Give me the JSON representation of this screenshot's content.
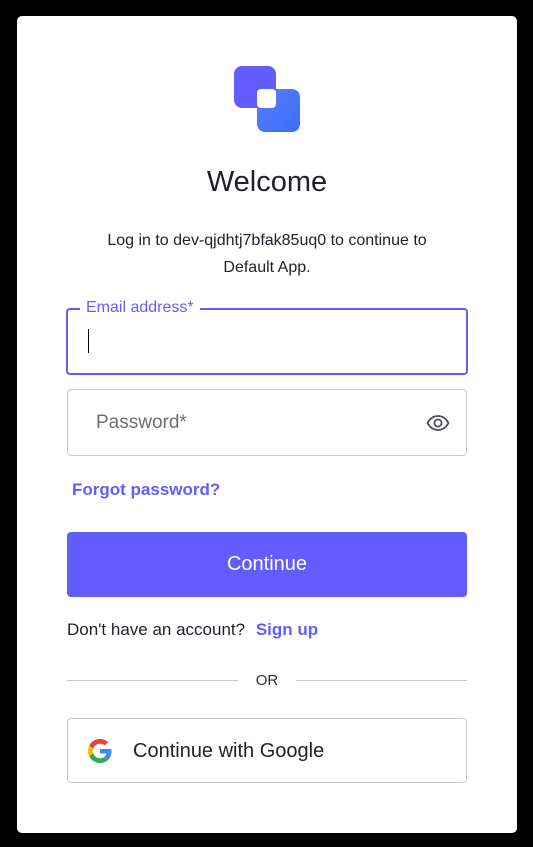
{
  "header": {
    "logo_icon": "app-logo-icon",
    "title": "Welcome",
    "subtitle_line1": "Log in to dev-qjdhtj7bfak85uq0 to continue to",
    "subtitle_line2": "Default App."
  },
  "form": {
    "email_label": "Email address*",
    "email_value": "",
    "password_placeholder": "Password*",
    "password_toggle_icon": "eye-icon",
    "forgot_password": "Forgot password?",
    "continue_label": "Continue"
  },
  "signup": {
    "prompt": "Don't have an account?",
    "link": "Sign up"
  },
  "divider": {
    "text": "OR"
  },
  "social": {
    "google_icon": "google-icon",
    "google_label": "Continue with Google"
  },
  "colors": {
    "accent": "#635dff",
    "logo_light": "#635dff",
    "logo_dark": "#3f6ffc",
    "background": "#000000",
    "card": "#ffffff",
    "text": "#1e212a",
    "border": "#c9cace"
  }
}
